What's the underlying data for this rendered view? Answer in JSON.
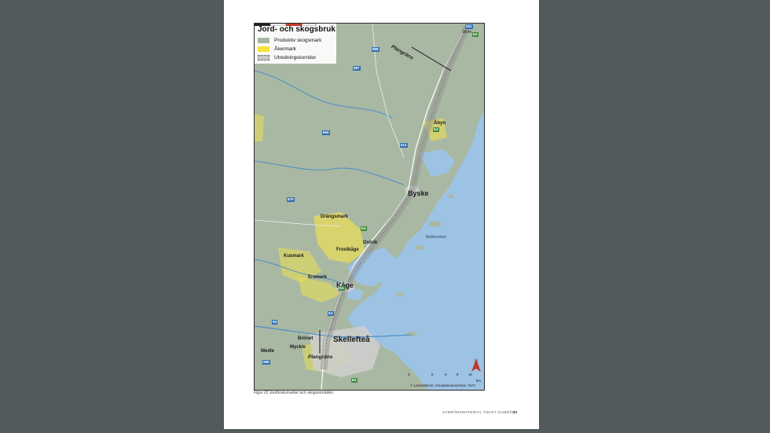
{
  "legend": {
    "title": "Jord- och skogsbruk",
    "items": [
      {
        "label": "Produktiv skogsmark",
        "color": "#a8b5a2"
      },
      {
        "label": "Åkermark",
        "color": "#f5e33a"
      },
      {
        "label": "Utredningskorridor",
        "color": "#9a9a9a"
      }
    ]
  },
  "places": {
    "javre": "Jävre",
    "abyn": "Åbyn",
    "byske": "Byske",
    "drangsmark": "Drängsmark",
    "ostvik": "Ostvik",
    "frostkage": "Frostkåge",
    "kusmark": "Kusmark",
    "ersmark": "Ersmark",
    "kage": "Kåge",
    "bronet": "Brönet",
    "skelleftea": "Skellefteå",
    "medle": "Medle",
    "myckle": "Myckle"
  },
  "water_labels": {
    "bottenviken": "Bottenviken"
  },
  "plangrans_labels": [
    "Plangräns",
    "Plangräns"
  ],
  "road_shields": [
    "501",
    "E4",
    "888",
    "887",
    "890",
    "912",
    "E4",
    "879",
    "E4",
    "E4",
    "95",
    "E4",
    "888",
    "E4"
  ],
  "scale": {
    "ticks": [
      "0",
      "5",
      "6",
      "8",
      "10"
    ],
    "unit": "km"
  },
  "north_label": "N",
  "attribution": "© Lantmäteriet, Geodatasamverkan, NVV",
  "caption": "Figur 23 Jordbruksmarker och skogsområden.",
  "footer": "SAMRÅDSMATERIAL TIDIGT SAMRÅD",
  "page_number": "33"
}
